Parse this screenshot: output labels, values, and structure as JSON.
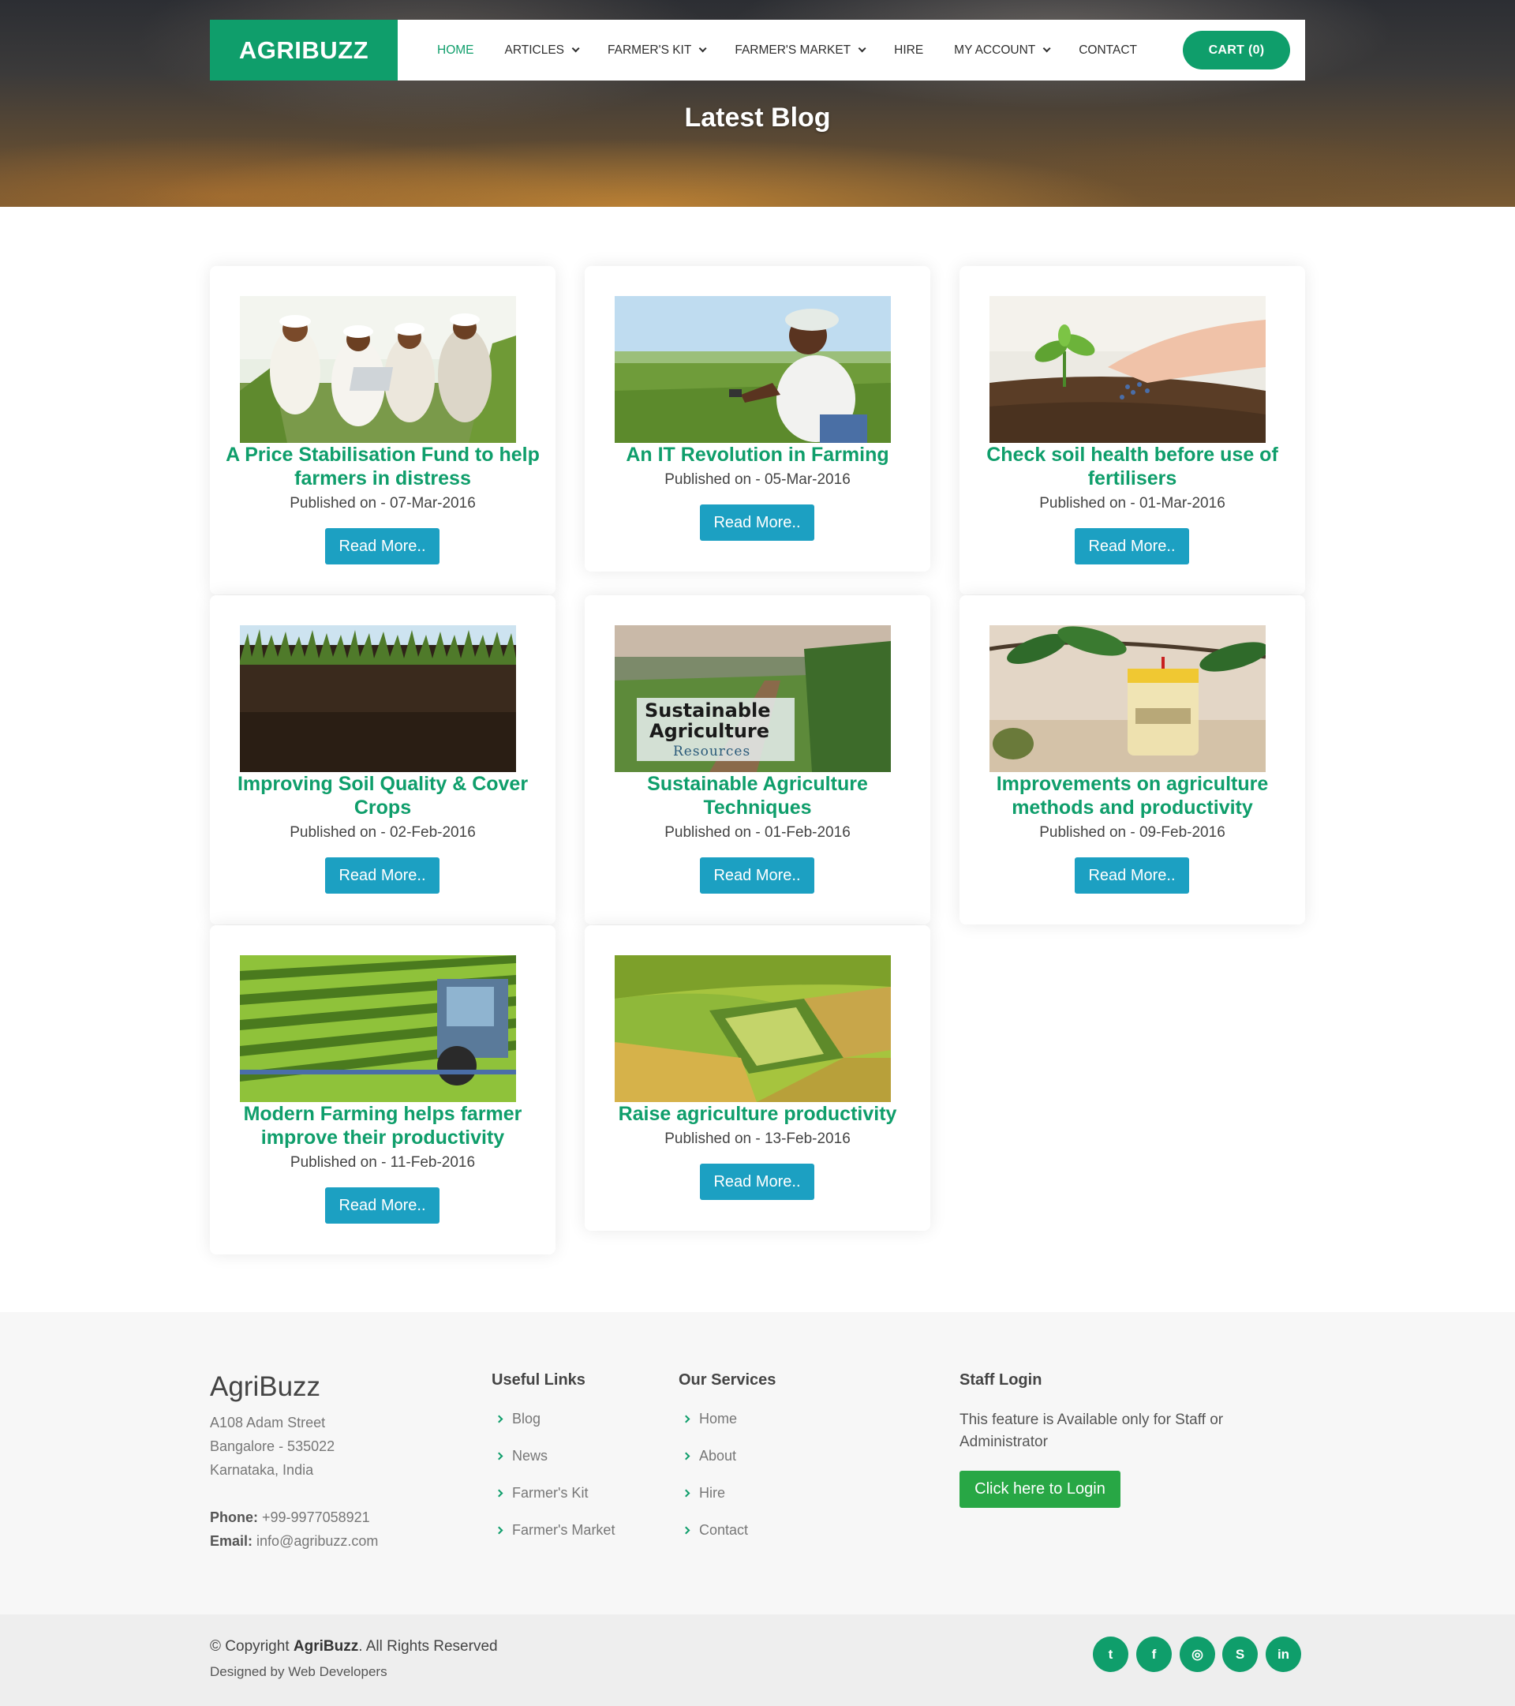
{
  "header": {
    "logo": "AGRIBUZZ",
    "nav": [
      {
        "label": "HOME",
        "dropdown": false,
        "active": true
      },
      {
        "label": "ARTICLES",
        "dropdown": true,
        "active": false
      },
      {
        "label": "FARMER'S KIT",
        "dropdown": true,
        "active": false
      },
      {
        "label": "FARMER'S MARKET",
        "dropdown": true,
        "active": false
      },
      {
        "label": "HIRE",
        "dropdown": false,
        "active": false
      },
      {
        "label": "MY ACCOUNT",
        "dropdown": true,
        "active": false
      },
      {
        "label": "CONTACT",
        "dropdown": false,
        "active": false
      }
    ],
    "cart_label": "CART (0)"
  },
  "hero": {
    "title": "Latest Blog"
  },
  "blog": {
    "read_more": "Read More..",
    "posts": [
      {
        "title": "A Price Stabilisation Fund to help farmers in distress",
        "date": "Published on - 07-Mar-2016"
      },
      {
        "title": "An IT Revolution in Farming",
        "date": "Published on - 05-Mar-2016"
      },
      {
        "title": "Check soil health before use of fertilisers",
        "date": "Published on - 01-Mar-2016"
      },
      {
        "title": "Improving Soil Quality & Cover Crops",
        "date": "Published on - 02-Feb-2016"
      },
      {
        "title": "Sustainable Agriculture Techniques",
        "date": "Published on - 01-Feb-2016",
        "image_text": [
          "Sustainable",
          "Agriculture",
          "Resources"
        ]
      },
      {
        "title": "Improvements on agriculture methods and productivity",
        "date": "Published on - 09-Feb-2016"
      },
      {
        "title": "Modern Farming helps farmer improve their productivity",
        "date": "Published on - 11-Feb-2016"
      },
      {
        "title": "Raise agriculture productivity",
        "date": "Published on - 13-Feb-2016"
      }
    ]
  },
  "footer": {
    "brand": "AgriBuzz",
    "address": [
      "A108 Adam Street",
      "Bangalore - 535022",
      "Karnataka, India"
    ],
    "phone_label": "Phone:",
    "phone": "+99-9977058921",
    "email_label": "Email:",
    "email": "info@agribuzz.com",
    "useful_links": {
      "heading": "Useful Links",
      "items": [
        "Blog",
        "News",
        "Farmer's Kit",
        "Farmer's Market"
      ]
    },
    "services": {
      "heading": "Our Services",
      "items": [
        "Home",
        "About",
        "Hire",
        "Contact"
      ]
    },
    "staff": {
      "heading": "Staff Login",
      "text": "This feature is Available only for Staff or Administrator",
      "button": "Click here to Login"
    },
    "copyright_prefix": "© Copyright",
    "copyright_brand": "AgriBuzz",
    "copyright_suffix": ". All Rights Reserved",
    "designed_by": "Designed by Web Developers",
    "social": [
      {
        "icon": "twitter-icon",
        "glyph": "t"
      },
      {
        "icon": "facebook-icon",
        "glyph": "f"
      },
      {
        "icon": "instagram-icon",
        "glyph": "◎"
      },
      {
        "icon": "skype-icon",
        "glyph": "S"
      },
      {
        "icon": "linkedin-icon",
        "glyph": "in"
      }
    ]
  },
  "colors": {
    "brand": "#0f9e6b",
    "read_more": "#1ca0c2",
    "login": "#28a745"
  }
}
